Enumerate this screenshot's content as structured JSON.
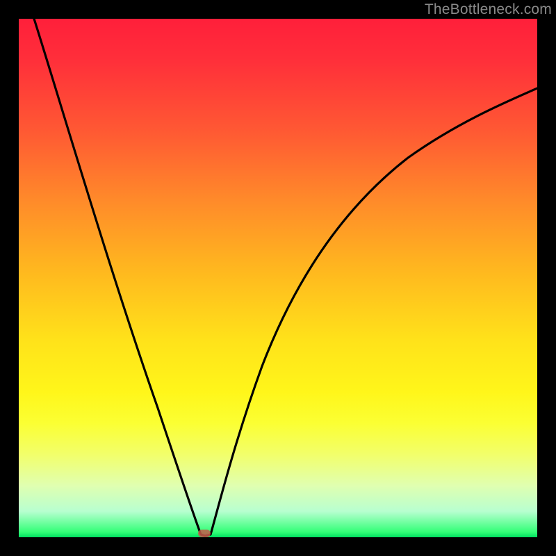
{
  "watermark": {
    "text": "TheBottleneck.com"
  },
  "colors": {
    "gradient_top": "#ff1f3a",
    "gradient_mid": "#ffe21a",
    "gradient_bottom": "#00e060",
    "curve": "#000000",
    "marker": "#c45a4a",
    "frame": "#000000"
  },
  "chart_data": {
    "type": "line",
    "title": "",
    "xlabel": "",
    "ylabel": "",
    "xlim": [
      0,
      100
    ],
    "ylim": [
      0,
      100
    ],
    "grid": false,
    "note": "V-shaped bottleneck curve; values are approximate pixel readings mapped to 0–100 axes. Minimum ≈ (35, 0). Left branch descends steeply from top-left; right branch rises and decelerates toward upper right.",
    "series": [
      {
        "name": "bottleneck-curve",
        "x": [
          3,
          6,
          10,
          14,
          18,
          22,
          26,
          30,
          33,
          35,
          37,
          40,
          44,
          50,
          56,
          64,
          72,
          80,
          88,
          96,
          100
        ],
        "y": [
          100,
          92,
          80,
          68,
          56,
          44,
          33,
          21,
          10,
          0,
          10,
          23,
          38,
          54,
          64,
          72,
          78,
          82,
          85,
          87,
          88
        ]
      }
    ],
    "marker": {
      "x": 35,
      "y": 0,
      "shape": "rounded-rect"
    }
  }
}
